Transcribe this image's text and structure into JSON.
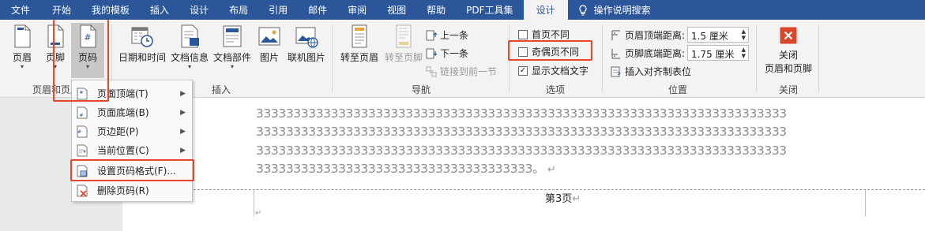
{
  "tabs": [
    "文件",
    "开始",
    "我的模板",
    "插入",
    "设计",
    "布局",
    "引用",
    "邮件",
    "审阅",
    "视图",
    "帮助",
    "PDF工具集",
    "设计",
    "操作说明搜索"
  ],
  "groups": {
    "header_footer": {
      "label": "页眉和页脚",
      "header_btn": "页眉",
      "footer_btn": "页脚",
      "pagenum_btn": "页码"
    },
    "insert": {
      "label": "插入",
      "datetime_btn": "日期和时间",
      "docinfo_btn": "文档信息",
      "docparts_btn": "文档部件",
      "picture_btn": "图片",
      "onlinepic_btn": "联机图片"
    },
    "navigation": {
      "label": "导航",
      "goto_header_btn": "转至页眉",
      "goto_footer_btn": "转至页脚",
      "prev_btn": "上一条",
      "next_btn": "下一条",
      "link_prev_btn": "链接到前一节"
    },
    "options": {
      "label": "选项",
      "first_page": "首页不同",
      "odd_even": "奇偶页不同",
      "show_doc_text": "显示文档文字"
    },
    "position": {
      "label": "位置",
      "header_top_label": "页眉顶端距离:",
      "header_top_value": "1.5 厘米",
      "footer_bottom_label": "页脚底端距离:",
      "footer_bottom_value": "1.75 厘米",
      "insert_align_tab": "插入对齐制表位"
    },
    "close": {
      "label": "关闭",
      "close_btn_line1": "关闭",
      "close_btn_line2": "页眉和页脚"
    }
  },
  "menu": {
    "top": "页面顶端(T)",
    "bottom": "页面底端(B)",
    "margin": "页边距(P)",
    "current": "当前位置(C)",
    "format": "设置页码格式(F)...",
    "remove": "删除页码(R)"
  },
  "document": {
    "line1": "33333333333333333333333333333333333333333333333333333333333333333333333",
    "line2": "33333333333333333333333333333333333333333333333333333333333333333333333",
    "line3": "33333333333333333333333333333333333333333333333333333333333333333333333",
    "line4": "3333333333333333333333333333333333333。",
    "footer_page_label": "第3页"
  },
  "colors": {
    "accent": "#2b579a",
    "highlight_box": "#e8452c",
    "close_icon": "#d9472b"
  }
}
